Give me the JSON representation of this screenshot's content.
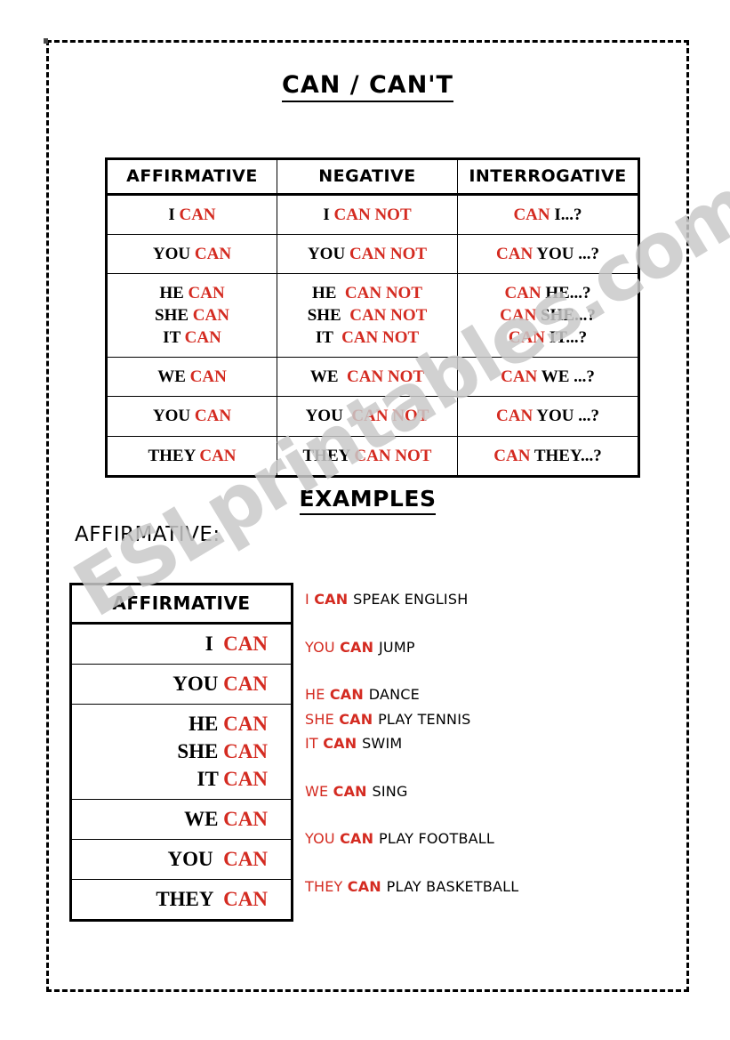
{
  "page": {
    "title": "CAN / CAN'T",
    "examples_heading": "EXAMPLES",
    "affirmative_label": "AFFIRMATIVE:",
    "watermark": "ESLprintables.com",
    "colors": {
      "red": "#d42b21",
      "black": "#000000",
      "watermark_gray": "#c9c9c9",
      "background": "#ffffff"
    }
  },
  "main_table": {
    "headers": [
      "AFFIRMATIVE",
      "NEGATIVE",
      "INTERROGATIVE"
    ],
    "rows": [
      {
        "affirmative": [
          {
            "t": "I ",
            "c": "black"
          },
          {
            "t": "CAN",
            "c": "red"
          }
        ],
        "negative": [
          {
            "t": "I ",
            "c": "black"
          },
          {
            "t": "CAN NOT",
            "c": "red"
          }
        ],
        "interrogative": [
          {
            "t": "CAN ",
            "c": "red"
          },
          {
            "t": "I...?",
            "c": "black"
          }
        ]
      },
      {
        "affirmative": [
          {
            "t": "YOU ",
            "c": "black"
          },
          {
            "t": "CAN",
            "c": "red"
          }
        ],
        "negative": [
          {
            "t": "YOU ",
            "c": "black"
          },
          {
            "t": "CAN NOT",
            "c": "red"
          }
        ],
        "interrogative": [
          {
            "t": "CAN ",
            "c": "red"
          },
          {
            "t": "YOU ...?",
            "c": "black"
          }
        ]
      },
      {
        "affirmative": [
          {
            "t": "HE ",
            "c": "black"
          },
          {
            "t": "CAN",
            "c": "red"
          },
          {
            "t": "\n",
            "c": "black"
          },
          {
            "t": "SHE ",
            "c": "black"
          },
          {
            "t": "CAN",
            "c": "red"
          },
          {
            "t": "\n",
            "c": "black"
          },
          {
            "t": "IT ",
            "c": "black"
          },
          {
            "t": "CAN",
            "c": "red"
          }
        ],
        "negative": [
          {
            "t": "HE  ",
            "c": "black"
          },
          {
            "t": "CAN NOT",
            "c": "red"
          },
          {
            "t": "\n",
            "c": "black"
          },
          {
            "t": "SHE  ",
            "c": "black"
          },
          {
            "t": "CAN NOT",
            "c": "red"
          },
          {
            "t": "\n",
            "c": "black"
          },
          {
            "t": "IT  ",
            "c": "black"
          },
          {
            "t": "CAN NOT",
            "c": "red"
          }
        ],
        "interrogative": [
          {
            "t": "CAN ",
            "c": "red"
          },
          {
            "t": "HE...?",
            "c": "black"
          },
          {
            "t": "\n",
            "c": "black"
          },
          {
            "t": "CAN ",
            "c": "red"
          },
          {
            "t": "SHE...?",
            "c": "black"
          },
          {
            "t": "\n",
            "c": "black"
          },
          {
            "t": "CAN ",
            "c": "red"
          },
          {
            "t": "IT...?",
            "c": "black"
          }
        ]
      },
      {
        "affirmative": [
          {
            "t": "WE ",
            "c": "black"
          },
          {
            "t": "CAN",
            "c": "red"
          }
        ],
        "negative": [
          {
            "t": "WE  ",
            "c": "black"
          },
          {
            "t": "CAN NOT",
            "c": "red"
          }
        ],
        "interrogative": [
          {
            "t": "CAN ",
            "c": "red"
          },
          {
            "t": "WE ...?",
            "c": "black"
          }
        ]
      },
      {
        "affirmative": [
          {
            "t": "YOU ",
            "c": "black"
          },
          {
            "t": "CAN",
            "c": "red"
          }
        ],
        "negative": [
          {
            "t": "YOU  ",
            "c": "black"
          },
          {
            "t": "CAN NOT",
            "c": "red"
          }
        ],
        "interrogative": [
          {
            "t": "CAN ",
            "c": "red"
          },
          {
            "t": "YOU ...?",
            "c": "black"
          }
        ]
      },
      {
        "affirmative": [
          {
            "t": "THEY ",
            "c": "black"
          },
          {
            "t": "CAN",
            "c": "red"
          }
        ],
        "negative": [
          {
            "t": "THEY ",
            "c": "black"
          },
          {
            "t": "CAN NOT",
            "c": "red"
          }
        ],
        "interrogative": [
          {
            "t": "CAN ",
            "c": "red"
          },
          {
            "t": "THEY...?",
            "c": "black"
          }
        ]
      }
    ]
  },
  "affirmative_table": {
    "header": "AFFIRMATIVE",
    "rows": [
      [
        {
          "t": "I  ",
          "c": "black"
        },
        {
          "t": "CAN",
          "c": "red"
        }
      ],
      [
        {
          "t": "YOU ",
          "c": "black"
        },
        {
          "t": "CAN",
          "c": "red"
        }
      ],
      [
        {
          "t": "HE ",
          "c": "black"
        },
        {
          "t": "CAN",
          "c": "red"
        },
        {
          "t": "\n",
          "c": "black"
        },
        {
          "t": "SHE ",
          "c": "black"
        },
        {
          "t": "CAN",
          "c": "red"
        },
        {
          "t": "\n",
          "c": "black"
        },
        {
          "t": "IT ",
          "c": "black"
        },
        {
          "t": "CAN",
          "c": "red"
        }
      ],
      [
        {
          "t": "WE ",
          "c": "black"
        },
        {
          "t": "CAN",
          "c": "red"
        }
      ],
      [
        {
          "t": "YOU  ",
          "c": "black"
        },
        {
          "t": "CAN",
          "c": "red"
        }
      ],
      [
        {
          "t": "THEY  ",
          "c": "black"
        },
        {
          "t": "CAN",
          "c": "red"
        }
      ]
    ]
  },
  "examples": [
    {
      "lines": [
        {
          "subject": "I ",
          "modal": "CAN ",
          "verb": "SPEAK ENGLISH"
        }
      ]
    },
    {
      "lines": [
        {
          "subject": "YOU ",
          "modal": "CAN ",
          "verb": "JUMP"
        }
      ]
    },
    {
      "lines": [
        {
          "subject": "HE ",
          "modal": "CAN ",
          "verb": "DANCE"
        },
        {
          "subject": "SHE ",
          "modal": "CAN ",
          "verb": "PLAY TENNIS"
        },
        {
          "subject": "IT ",
          "modal": "CAN ",
          "verb": "SWIM"
        }
      ]
    },
    {
      "lines": [
        {
          "subject": "WE ",
          "modal": "CAN ",
          "verb": "SING"
        }
      ]
    },
    {
      "lines": [
        {
          "subject": "YOU ",
          "modal": "CAN ",
          "verb": "PLAY FOOTBALL"
        }
      ]
    },
    {
      "lines": [
        {
          "subject": "THEY ",
          "modal": "CAN ",
          "verb": "PLAY BASKETBALL"
        }
      ]
    }
  ]
}
